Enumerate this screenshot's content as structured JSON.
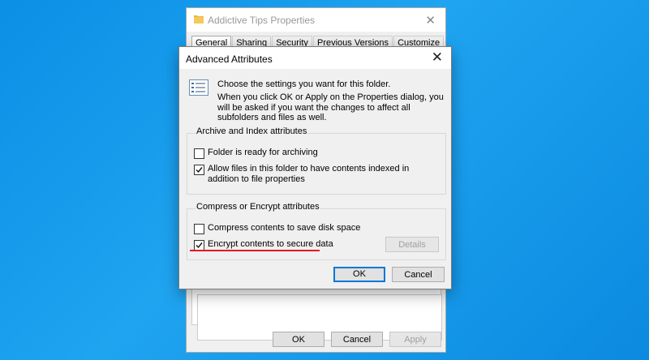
{
  "props_window": {
    "title": "Addictive Tips Properties",
    "tabs": [
      "General",
      "Sharing",
      "Security",
      "Previous Versions",
      "Customize"
    ],
    "ok_label": "OK",
    "cancel_label": "Cancel",
    "apply_label": "Apply"
  },
  "advanced": {
    "title": "Advanced Attributes",
    "intro_title": "Choose the settings you want for this folder.",
    "intro_body": "When you click OK or Apply on the Properties dialog, you will be asked if you want the changes to affect all subfolders and files as well.",
    "archive_group": {
      "legend": "Archive and Index attributes",
      "items": [
        {
          "label": "Folder is ready for archiving",
          "checked": false
        },
        {
          "label": "Allow files in this folder to have contents indexed in addition to file properties",
          "checked": true
        }
      ]
    },
    "compress_group": {
      "legend": "Compress or Encrypt attributes",
      "items": [
        {
          "label": "Compress contents to save disk space",
          "checked": false
        },
        {
          "label": "Encrypt contents to secure data",
          "checked": true
        }
      ],
      "details_label": "Details"
    },
    "ok_label": "OK",
    "cancel_label": "Cancel"
  },
  "colors": {
    "accent": "#0078d7",
    "highlight": "#e81123",
    "desktop": "#1fa4f0"
  }
}
